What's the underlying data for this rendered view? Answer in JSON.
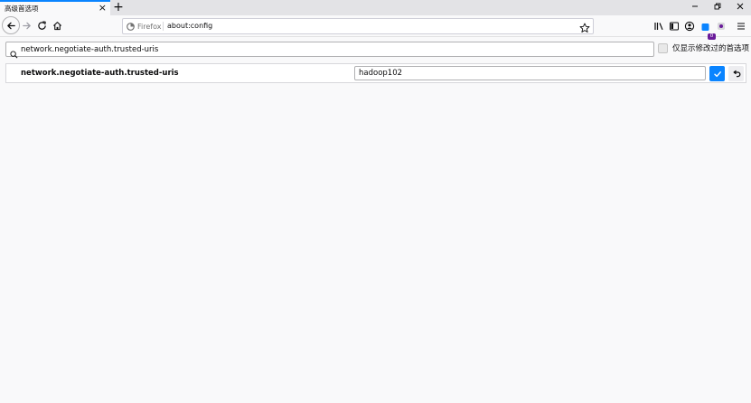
{
  "tab": {
    "title": "高级首选项"
  },
  "urlbar": {
    "identity_label": "Firefox",
    "url": "about:config"
  },
  "toolbar": {
    "badge_count": "0"
  },
  "search": {
    "value": "network.negotiate-auth.trusted-uris"
  },
  "filter": {
    "label": "仅显示修改过的首选项",
    "checked": false
  },
  "preference": {
    "name": "network.negotiate-auth.trusted-uris",
    "value": "hadoop102"
  },
  "colors": {
    "accent": "#0a84ff",
    "badge": "#6a1b9a",
    "background": "#f9f9fa"
  }
}
